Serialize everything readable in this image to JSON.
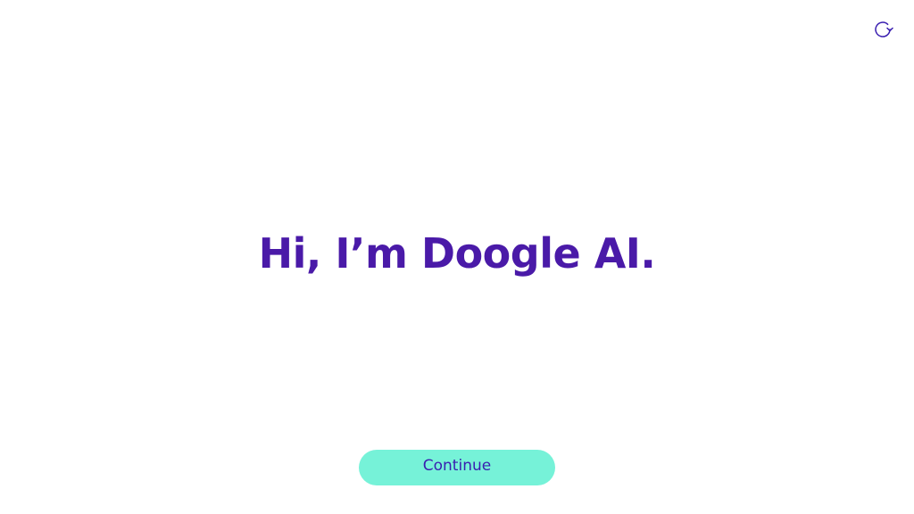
{
  "toolbar": {
    "reload_icon": "reload-icon"
  },
  "main": {
    "greeting": "Hi, I’m Doogle AI.",
    "continue_label": "Continue"
  },
  "colors": {
    "background": "#ffffff",
    "heading": "#4a1aa8",
    "button_background": "#76f2d8",
    "button_text": "#3a1fb0",
    "icon": "#3a1fb0"
  }
}
